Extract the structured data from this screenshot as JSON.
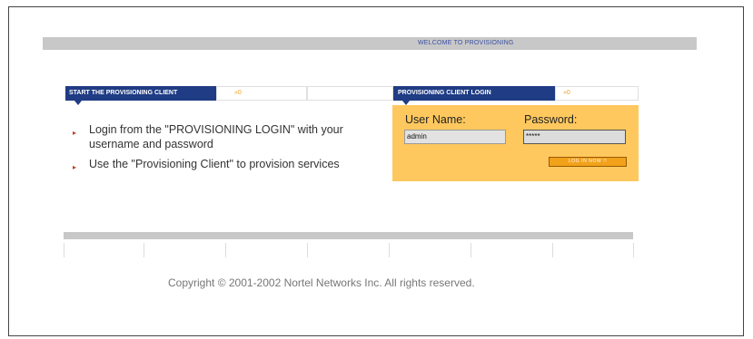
{
  "header": {
    "welcome_text": "WELCOME TO PROVISIONING"
  },
  "start_panel": {
    "title": "START THE PROVISIONING CLIENT",
    "arrow_text": "»0",
    "instructions": [
      "Login from the \"PROVISIONING LOGIN\" with your username and password",
      "Use the \"Provisioning Client\" to provision services"
    ]
  },
  "login_panel": {
    "title": "PROVISIONING CLIENT LOGIN",
    "arrow_text": "»0",
    "username_label": "User Name:",
    "username_value": "admin",
    "password_label": "Password:",
    "password_value": "*****",
    "login_button": "LOG IN NOW !!"
  },
  "footer": {
    "copyright": "Copyright © 2001-2002 Nortel Networks Inc. All rights reserved."
  },
  "colors": {
    "header_blue": "#1f3c84",
    "login_bg": "#ffc85e",
    "button_orange": "#f2a11b",
    "bar_gray": "#c8c8c8"
  }
}
